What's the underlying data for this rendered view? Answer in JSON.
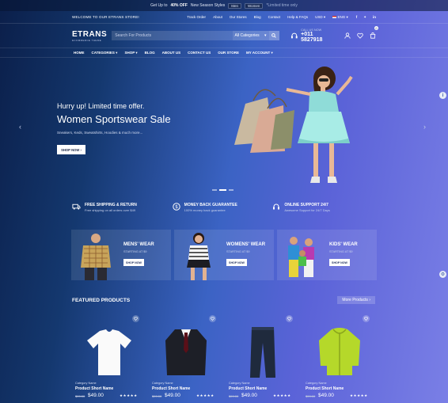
{
  "promo": {
    "prefix": "Get Up to",
    "bold": "40% OFF",
    "suffix": "New Season Styles",
    "men": "Men",
    "women": "Women",
    "limited": "*Limited time only"
  },
  "utility": {
    "welcome": "WELCOME TO OUR ETRANS STORE!",
    "links": [
      "Track Order",
      "About",
      "Our Stores",
      "Blog",
      "Contact",
      "Help & FAQs",
      "USD",
      "ENG"
    ]
  },
  "header": {
    "logo": "ETRANS",
    "logo_tag": "ECOMMERCE THEME",
    "search_placeholder": "Search For Products",
    "category": "All Categories",
    "call_label": "CALL US NOW",
    "phone": "+011 5827918",
    "cart_count": "0"
  },
  "nav": [
    "HOME",
    "CATEGORIES",
    "SHOP",
    "BLOG",
    "ABOUT US",
    "CONTACT US",
    "OUR STORE",
    "MY ACCOUNT"
  ],
  "hero": {
    "sub": "Hurry up! Limited time offer.",
    "title": "Women Sportswear Sale",
    "desc": "Sneakers, Keds, Sweatshirts, Hoodies & much more...",
    "button": "SHOP NOW"
  },
  "features": [
    {
      "title": "FREE SHIPPING & RETURN",
      "desc": "Free shipping on all orders over $49"
    },
    {
      "title": "MONEY BACK GUARANTEE",
      "desc": "100% money back guarantee"
    },
    {
      "title": "ONLINE SUPPORT 24/7",
      "desc": "Awesome Support for 24/7 Days"
    }
  ],
  "categories": [
    {
      "title": "MENS' WEAR",
      "starting": "STARTING AT $9",
      "button": "SHOP NOW"
    },
    {
      "title": "WOMENS' WEAR",
      "starting": "STARTING AT $9",
      "button": "SHOP NOW"
    },
    {
      "title": "KIDS' WEAR",
      "starting": "STARTING AT $9",
      "button": "SHOP NOW"
    }
  ],
  "featured": {
    "heading": "FEATURED PRODUCTS",
    "more": "More Products",
    "products": [
      {
        "category": "Category Name",
        "name": "Product Short Name",
        "old_price": "$99.00",
        "price": "$49.00",
        "stars": "★★★★★"
      },
      {
        "category": "Category Name",
        "name": "Product Short Name",
        "old_price": "$99.00",
        "price": "$49.00",
        "stars": "★★★★★"
      },
      {
        "category": "Category Name",
        "name": "Product Short Name",
        "old_price": "$99.00",
        "price": "$49.00",
        "stars": "★★★★★"
      },
      {
        "category": "Category Name",
        "name": "Product Short Name",
        "old_price": "$99.00",
        "price": "$49.00",
        "stars": "★★★★★"
      }
    ]
  }
}
